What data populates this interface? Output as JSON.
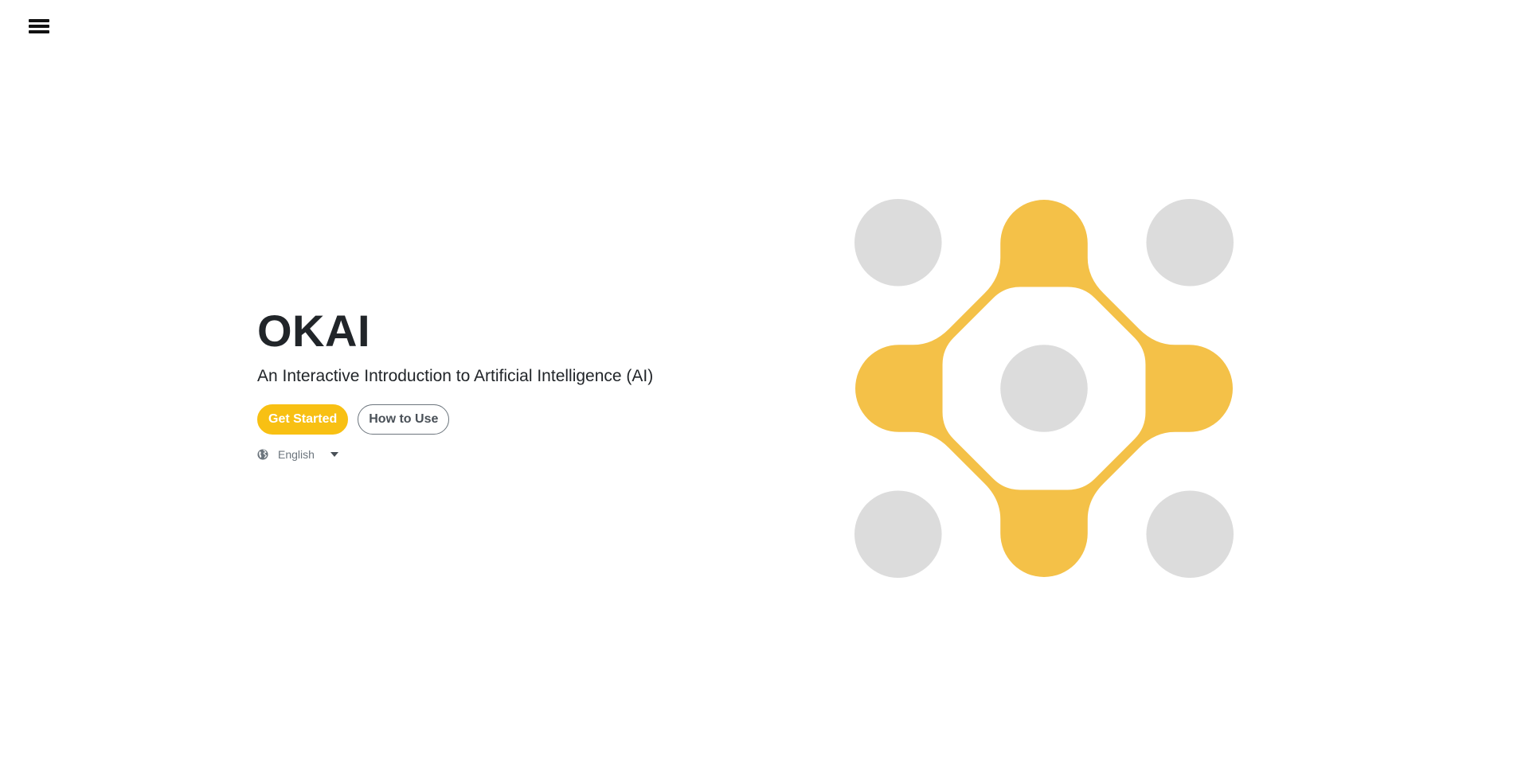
{
  "nav": {
    "menu_icon": "hamburger-menu-icon"
  },
  "hero": {
    "title": "OKAI",
    "subtitle": "An Interactive Introduction to Artificial Intelligence (AI)",
    "get_started_label": "Get Started",
    "how_to_use_label": "How to Use"
  },
  "language": {
    "icon": "globe-icon",
    "selected": "English",
    "caret_icon": "caret-down-icon"
  },
  "colors": {
    "accent": "#f8c013",
    "logo_yellow": "#f4c148",
    "logo_gray": "#dcdcdc"
  }
}
